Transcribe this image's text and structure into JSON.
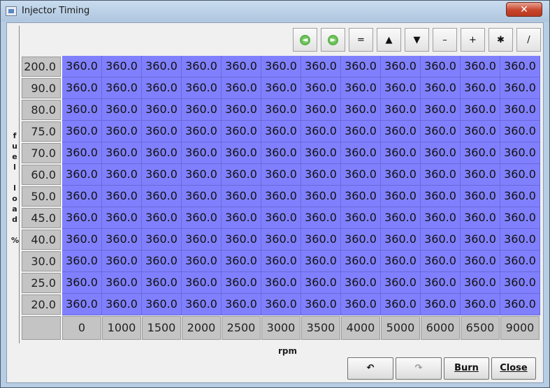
{
  "window": {
    "title": "Injector Timing",
    "close_glyph": "✕"
  },
  "toolbar": {
    "buttons": [
      {
        "name": "undo-green-icon",
        "glyph": "◄"
      },
      {
        "name": "redo-green-icon",
        "glyph": "►"
      },
      {
        "name": "equals-button",
        "glyph": "="
      },
      {
        "name": "increment-button",
        "glyph": "▲"
      },
      {
        "name": "decrement-button",
        "glyph": "▼"
      },
      {
        "name": "minus-button",
        "glyph": "–"
      },
      {
        "name": "plus-button",
        "glyph": "+"
      },
      {
        "name": "multiply-button",
        "glyph": "✱"
      },
      {
        "name": "pen-icon",
        "glyph": "/"
      }
    ]
  },
  "y_axis_label": "fuel load %",
  "x_axis_label": "rpm",
  "row_headers": [
    "200.0",
    "90.0",
    "80.0",
    "75.0",
    "70.0",
    "60.0",
    "50.0",
    "45.0",
    "40.0",
    "30.0",
    "25.0",
    "20.0"
  ],
  "col_headers": [
    "0",
    "1000",
    "1500",
    "2000",
    "2500",
    "3000",
    "3500",
    "4000",
    "5000",
    "6000",
    "6500",
    "9000"
  ],
  "cell_value": "360.0",
  "buttons": {
    "undo": "↶",
    "redo": "↷",
    "burn": "Burn",
    "close": "Close"
  },
  "colors": {
    "cell": "#8080ff",
    "header": "#c4c4c4"
  }
}
